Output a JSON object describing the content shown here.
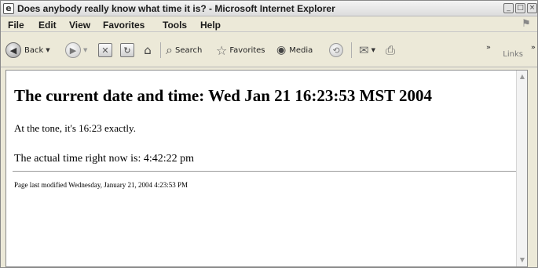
{
  "window": {
    "title": "Does anybody really know what time it is? - Microsoft Internet Explorer",
    "controls": [
      "minimize-icon",
      "maximize-icon",
      "close-icon"
    ]
  },
  "menu": {
    "items": [
      "File",
      "Edit",
      "View",
      "Favorites",
      "Tools",
      "Help"
    ]
  },
  "toolbar": {
    "back_label": "Back",
    "search_label": "Search",
    "favorites_label": "Favorites",
    "media_label": "Media",
    "links_label": "Links",
    "icons": [
      "back-icon",
      "forward-icon",
      "stop-icon",
      "refresh-icon",
      "home-icon",
      "search-icon",
      "favorites-star-icon",
      "media-icon",
      "history-icon",
      "mail-icon",
      "print-icon"
    ]
  },
  "page": {
    "heading": "The current date and time: Wed Jan 21 16:23:53 MST 2004",
    "tone_line": "At the tone, it's 16:23 exactly.",
    "actual_time_line": "The actual time right now is: 4:42:22 pm",
    "footer": "Page last modified Wednesday, January 21, 2004 4:23:53 PM"
  }
}
